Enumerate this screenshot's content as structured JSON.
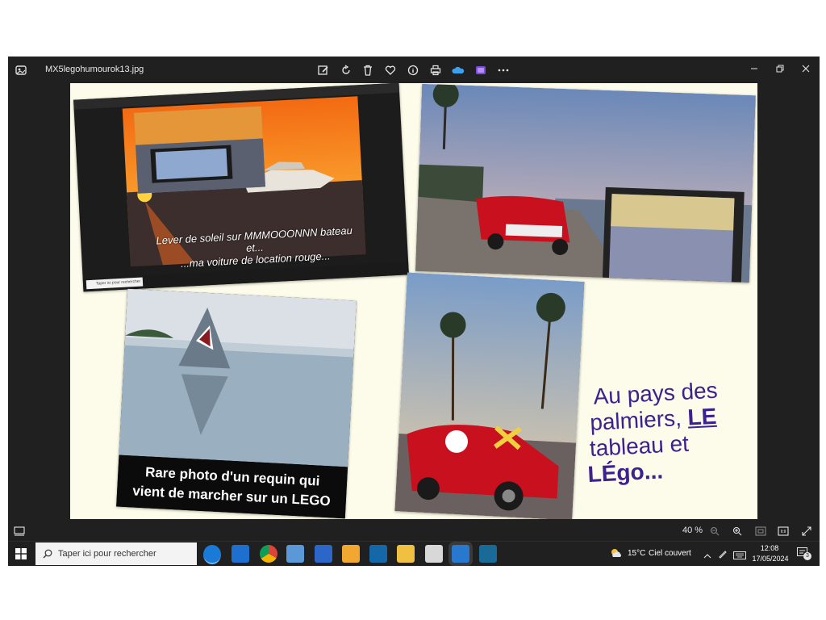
{
  "window": {
    "file_name": "MX5legohumourok13.jpg",
    "toolbar_icons": [
      "edit-icon",
      "rotate-icon",
      "delete-icon",
      "favorite-icon",
      "info-icon",
      "print-icon",
      "onedrive-icon",
      "clipchamp-icon",
      "more-icon"
    ],
    "controls": [
      "minimize-icon",
      "restore-icon",
      "close-icon"
    ]
  },
  "collage": {
    "sunrise_caption_line1": "Lever de soleil sur MMMOOONNN bateau",
    "sunrise_caption_line2": "et...",
    "sunrise_caption_line3": "...ma voiture de location rouge...",
    "shark_caption_line1": "Rare photo d'un requin qui",
    "shark_caption_line2": "vient de marcher sur un LEGO",
    "purple_line1": "Au pays des",
    "purple_line2a": "palmiers, ",
    "purple_line2b": "LE",
    "purple_line3": "tableau et",
    "purple_line4": "LÉgo...",
    "inner_search_placeholder": "Taper ici pour rechercher"
  },
  "bottombar": {
    "zoom_level": "40 %"
  },
  "taskbar": {
    "search_placeholder": "Taper ici pour rechercher",
    "weather_temp": "15°C",
    "weather_text": "Ciel couvert",
    "time": "12:08",
    "date": "17/05/2024",
    "notification_count": "3"
  },
  "colors": {
    "window_bg": "#202020",
    "canvas_bg": "#fdfbe9",
    "purple_text": "#3d2191",
    "car_red": "#c8101e"
  }
}
